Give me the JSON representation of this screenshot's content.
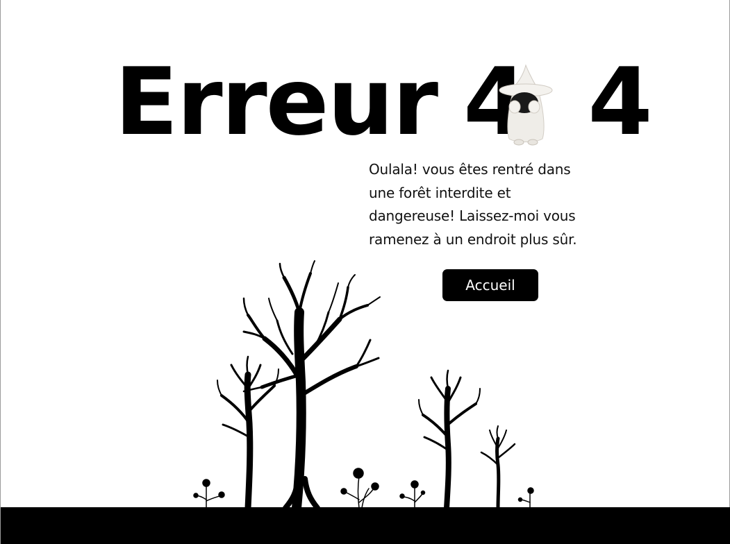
{
  "title": {
    "word": "Erreur",
    "digit_left": "4",
    "digit_right": "4"
  },
  "message": {
    "lines": [
      "Oulala! vous êtes rentré dans",
      "une forêt interdite et",
      "dangereuse! Laissez-moi vous",
      "ramenez à un endroit plus sûr."
    ]
  },
  "home_button": {
    "label": "Accueil"
  },
  "colors": {
    "background": "#ffffff",
    "ink": "#000000",
    "button_bg": "#000000",
    "button_text": "#ffffff"
  },
  "icons": {
    "zero_replacement": "wizard-icon",
    "scenery": [
      "tree-icon",
      "flower-icon"
    ]
  }
}
